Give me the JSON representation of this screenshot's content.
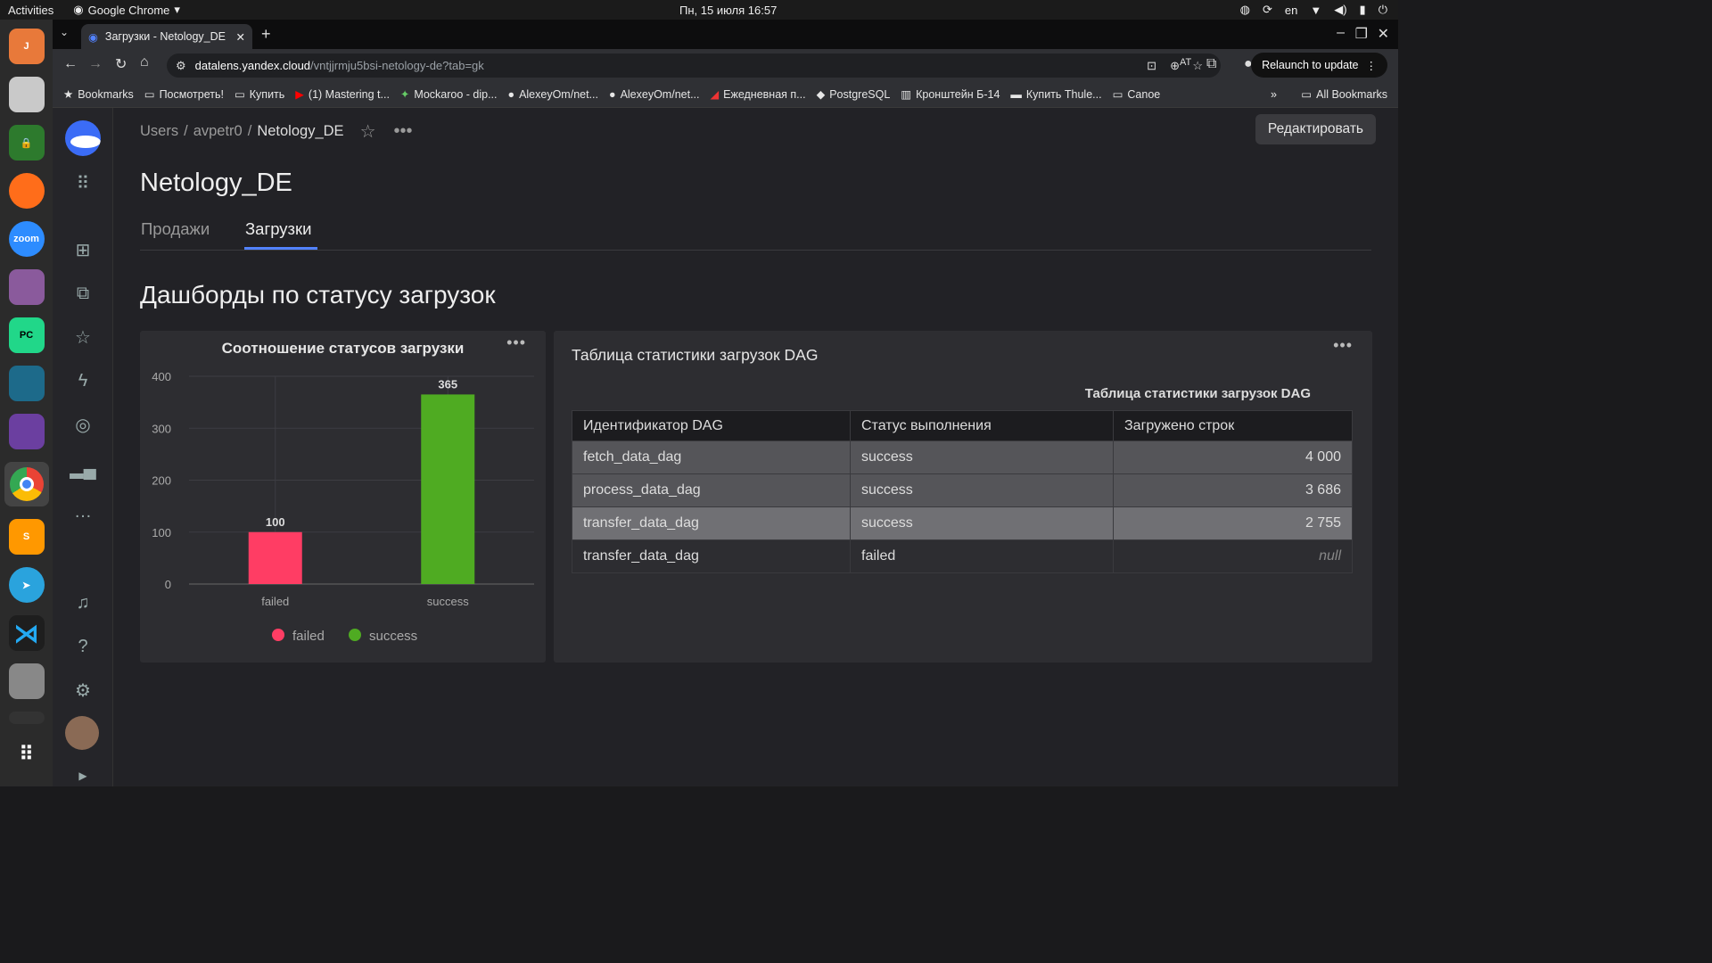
{
  "os": {
    "activities": "Activities",
    "app": "Google Chrome",
    "clock": "Пн, 15 июля  16:57",
    "lang": "en"
  },
  "browser": {
    "tab_title": "Загрузки - Netology_DE",
    "url_host": "datalens.yandex.cloud",
    "url_path": "/vntjjrmju5bsi-netology-de?tab=gk",
    "relaunch": "Relaunch to update",
    "bookmarks": [
      "Bookmarks",
      "Посмотреть!",
      "Купить",
      "(1) Mastering t...",
      "Mockaroo - dip...",
      "AlexeyOm/net...",
      "AlexeyOm/net...",
      "Ежедневная п...",
      "PostgreSQL",
      "Кронштейн Б-14",
      "Купить Thule...",
      "Canoe"
    ],
    "all_bookmarks": "All Bookmarks"
  },
  "header": {
    "crumb_users": "Users",
    "crumb_user": "avpetr0",
    "crumb_current": "Netology_DE",
    "edit": "Редактировать"
  },
  "page": {
    "title": "Netology_DE",
    "tabs": [
      "Продажи",
      "Загрузки"
    ],
    "section": "Дашборды по статусу загрузок"
  },
  "chart_data": {
    "type": "bar",
    "title": "Соотношение статусов загрузки",
    "categories": [
      "failed",
      "success"
    ],
    "values": [
      100,
      365
    ],
    "colors": [
      "#ff3d64",
      "#4fab22"
    ],
    "ylim": [
      0,
      400
    ],
    "yticks": [
      0,
      100,
      200,
      300,
      400
    ],
    "legend": [
      "failed",
      "success"
    ],
    "legend_position": "bottom"
  },
  "table": {
    "card_title": "Таблица статистики загрузок DAG",
    "subtitle": "Таблица статистики загрузок DAG",
    "headers": [
      "Идентификатор DAG",
      "Статус выполнения",
      "Загружено строк"
    ],
    "rows": [
      [
        "fetch_data_dag",
        "success",
        "4 000"
      ],
      [
        "process_data_dag",
        "success",
        "3 686"
      ],
      [
        "transfer_data_dag",
        "success",
        "2 755"
      ],
      [
        "transfer_data_dag",
        "failed",
        "null"
      ]
    ]
  }
}
